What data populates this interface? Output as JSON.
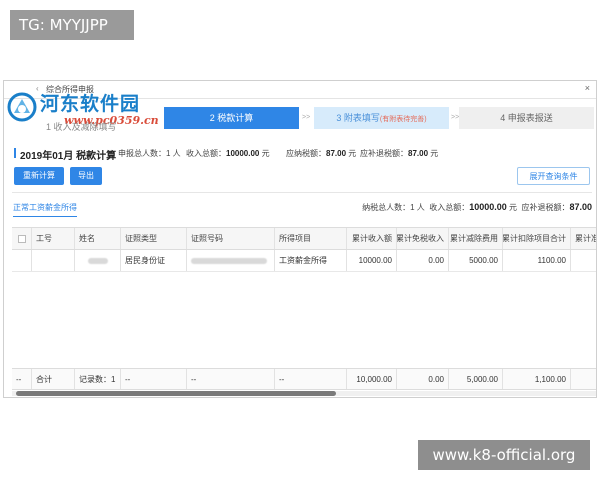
{
  "watermark_top": "TG: MYYJJPP",
  "watermark_bottom": "www.k8-official.org",
  "window": {
    "title": "综合所得申报",
    "close": "×"
  },
  "logo": {
    "name": "河东软件园",
    "url": "www.pc0359.cn",
    "step1": "1 收入及减除填写"
  },
  "steps": [
    {
      "label": "2 税款计算"
    },
    {
      "label": "3 附表填写",
      "hint": "(有附表待完善)"
    },
    {
      "label": "4 申报表报送"
    }
  ],
  "arrows": ">>",
  "summary": {
    "period": "2019年01月 税款计算",
    "declare_count_label": "申报总人数：",
    "declare_count": "1 人",
    "income_label": "收入总额：",
    "income": "10000.00",
    "income_unit": "元",
    "tax_payable_label": "应纳税额：",
    "tax_payable": "87.00",
    "tax_payable_unit": "元",
    "refund_label": "应补退税额：",
    "refund": "87.00",
    "refund_unit": "元"
  },
  "buttons": {
    "recalc": "重新计算",
    "export": "导出",
    "expand_query": "展开查询条件"
  },
  "tab": {
    "label": "正常工资薪金所得"
  },
  "totals": {
    "taxpayer_label": "纳税总人数：",
    "taxpayer": "1 人",
    "income_label": "收入总额：",
    "income": "10000.00",
    "income_unit": "元",
    "refund_label": "应补退税额：",
    "refund": "87.00"
  },
  "table": {
    "columns": [
      "工号",
      "姓名",
      "证照类型",
      "证照号码",
      "所得项目",
      "累计收入额",
      "累计免税收入",
      "累计减除费用",
      "累计扣除项目合计",
      "累计准予"
    ],
    "row": [
      "",
      "",
      "居民身份证",
      "",
      "工资薪金所得",
      "10000.00",
      "0.00",
      "5000.00",
      "1100.00",
      ""
    ],
    "footer": [
      "--",
      "合计",
      "记录数：1",
      "--",
      "--",
      "--",
      "10,000.00",
      "0.00",
      "5,000.00",
      "1,100.00",
      ""
    ]
  }
}
